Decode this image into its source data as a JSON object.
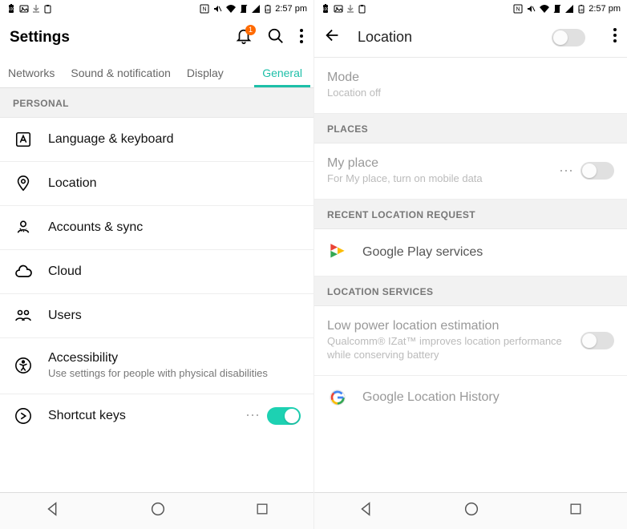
{
  "statusbar": {
    "time": "2:57 pm"
  },
  "settings": {
    "title": "Settings",
    "badge": "1",
    "tabs": [
      "Networks",
      "Sound & notification",
      "Display",
      "General"
    ],
    "active_tab": 3,
    "section": "PERSONAL",
    "items": [
      {
        "label": "Language & keyboard"
      },
      {
        "label": "Location"
      },
      {
        "label": "Accounts & sync"
      },
      {
        "label": "Cloud"
      },
      {
        "label": "Users"
      },
      {
        "label": "Accessibility",
        "sub": "Use settings for people with physical disabilities"
      },
      {
        "label": "Shortcut keys",
        "toggle": true
      }
    ]
  },
  "location": {
    "title": "Location",
    "master_toggle": false,
    "mode": {
      "label": "Mode",
      "sub": "Location off"
    },
    "places_header": "PLACES",
    "my_place": {
      "label": "My place",
      "sub": "For My place, turn on mobile data",
      "toggle": false
    },
    "recent_header": "RECENT LOCATION REQUEST",
    "recent_item": "Google Play services",
    "services_header": "LOCATION SERVICES",
    "low_power": {
      "label": "Low power location estimation",
      "sub": "Qualcomm® IZat™ improves location performance while conserving battery",
      "toggle": false
    },
    "history": "Google Location History"
  }
}
